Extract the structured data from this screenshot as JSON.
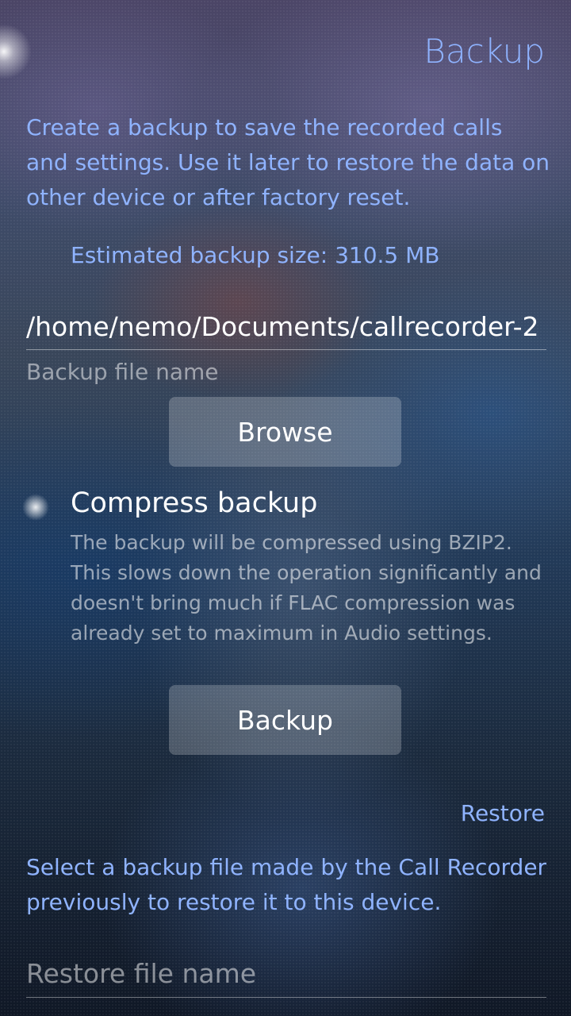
{
  "header": {
    "title": "Backup"
  },
  "backup": {
    "description": "Create a backup to save the recorded calls and settings. Use it later to restore the data on other device or after factory reset.",
    "estimated_size": "Estimated backup size: 310.5 MB",
    "file_name_value": "/home/nemo/Documents/callrecorder-2",
    "file_name_label": "Backup file name",
    "browse_label": "Browse",
    "compress": {
      "label": "Compress backup",
      "checked": true,
      "description": "The backup will be compressed using BZIP2. This slows down the operation significantly and doesn't bring much if FLAC compression was already set to maximum in Audio settings."
    },
    "backup_button_label": "Backup"
  },
  "restore": {
    "section_header": "Restore",
    "description": "Select a backup file made by the Call Recorder previously to restore it to this device.",
    "file_name_placeholder": "Restore file name"
  },
  "colors": {
    "highlight": "#8fb3ff",
    "primary_text": "#ffffff"
  }
}
